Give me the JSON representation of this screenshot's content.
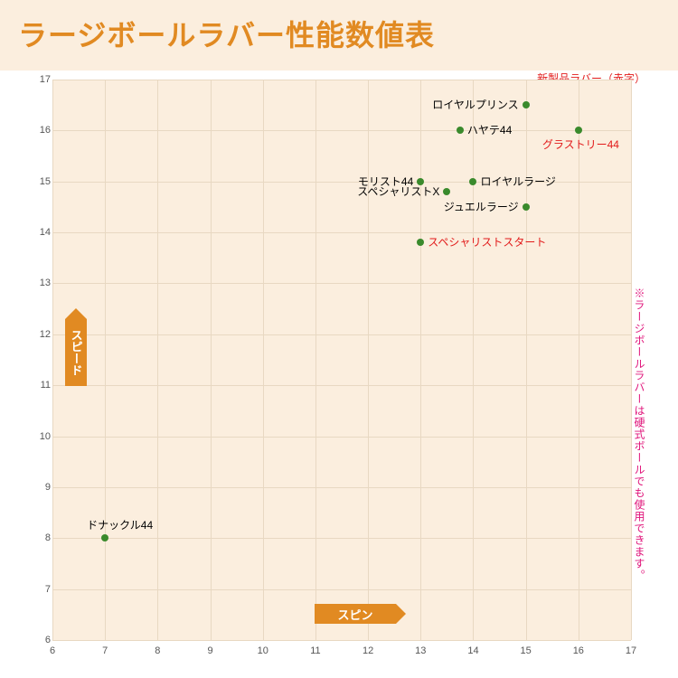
{
  "title": "ラージボールラバー性能数値表",
  "legend_note": "新製品ラバー（赤字）",
  "side_note": "※ラージボールラバーは硬式ボールでも使用できます。",
  "axis_y_label": "スピード",
  "axis_x_label": "スピン",
  "chart_data": {
    "type": "scatter",
    "xlabel": "スピン",
    "ylabel": "スピード",
    "xlim": [
      6,
      17
    ],
    "ylim": [
      6,
      17
    ],
    "x_ticks": [
      6,
      7,
      8,
      9,
      10,
      11,
      12,
      13,
      14,
      15,
      16,
      17
    ],
    "y_ticks": [
      6,
      7,
      8,
      9,
      10,
      11,
      12,
      13,
      14,
      15,
      16,
      17
    ],
    "series": [
      {
        "name": "ドナックル44",
        "x": 7.0,
        "y": 8.0,
        "new": false,
        "label_side": "top"
      },
      {
        "name": "モリスト44",
        "x": 13.0,
        "y": 15.0,
        "new": false,
        "label_side": "left"
      },
      {
        "name": "スペシャリストX",
        "x": 13.5,
        "y": 14.8,
        "new": false,
        "label_side": "left"
      },
      {
        "name": "スペシャリストスタート",
        "x": 13.0,
        "y": 13.8,
        "new": true,
        "label_side": "right"
      },
      {
        "name": "ハヤテ44",
        "x": 13.75,
        "y": 16.0,
        "new": false,
        "label_side": "right"
      },
      {
        "name": "ロイヤルラージ",
        "x": 14.0,
        "y": 15.0,
        "new": false,
        "label_side": "right"
      },
      {
        "name": "ジュエルラージ",
        "x": 15.0,
        "y": 14.5,
        "new": false,
        "label_side": "left"
      },
      {
        "name": "ロイヤルプリンス",
        "x": 15.0,
        "y": 16.5,
        "new": false,
        "label_side": "left"
      },
      {
        "name": "グラストリー44",
        "x": 16.0,
        "y": 16.0,
        "new": true,
        "label_side": "bottom"
      }
    ]
  }
}
